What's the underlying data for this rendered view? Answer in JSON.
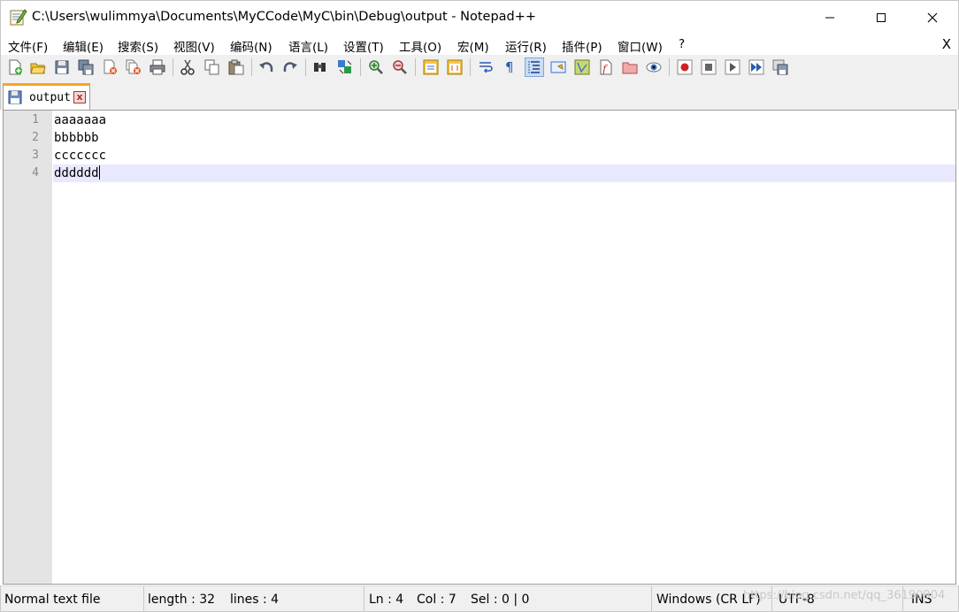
{
  "window": {
    "title": "C:\\Users\\wulimmya\\Documents\\MyCCode\\MyC\\bin\\Debug\\output - Notepad++",
    "app_icon": "notepad-plus-plus-icon",
    "controls": {
      "minimize": "minimize-icon",
      "maximize": "maximize-icon",
      "close": "close-icon"
    }
  },
  "menu": {
    "items": [
      "文件(F)",
      "编辑(E)",
      "搜索(S)",
      "视图(V)",
      "编码(N)",
      "语言(L)",
      "设置(T)",
      "工具(O)",
      "宏(M)",
      "运行(R)",
      "插件(P)",
      "窗口(W)",
      "?"
    ],
    "close_label": "X"
  },
  "toolbar": {
    "buttons": [
      "new-file-icon",
      "open-file-icon",
      "save-icon",
      "save-all-icon",
      "close-icon",
      "close-all-icon",
      "print-icon",
      "cut-icon",
      "copy-icon",
      "paste-icon",
      "undo-icon",
      "redo-icon",
      "find-icon",
      "replace-icon",
      "zoom-in-icon",
      "zoom-out-icon",
      "sync-vertical-icon",
      "sync-horizontal-icon",
      "word-wrap-icon",
      "show-all-characters-icon",
      "indent-guide-icon",
      "user-defined-language-icon",
      "document-map-icon",
      "function-list-icon",
      "folder-as-workspace-icon",
      "monitoring-icon",
      "record-macro-icon",
      "stop-recording-icon",
      "playback-macro-icon",
      "run-macro-multiple-icon",
      "save-macro-icon"
    ],
    "active": "indent-guide-icon"
  },
  "tabs": [
    {
      "label": "output",
      "icon": "saved-file-icon",
      "close": "x"
    }
  ],
  "editor": {
    "lines": [
      {
        "number": "1",
        "text": "aaaaaaa"
      },
      {
        "number": "2",
        "text": "bbbbbb"
      },
      {
        "number": "3",
        "text": "ccccccc"
      },
      {
        "number": "4",
        "text": "dddddd"
      }
    ],
    "current_line": 4
  },
  "status": {
    "file_type": "Normal text file",
    "length": "length : 32",
    "lines": "lines : 4",
    "ln": "Ln : 4",
    "col": "Col : 7",
    "sel": "Sel : 0 | 0",
    "eol": "Windows (CR LF)",
    "encoding": "UTF-8",
    "mode": "INS"
  },
  "watermark": "https://blog.csdn.net/qq_36190904",
  "colors": {
    "tab_accent": "#f5a623",
    "current_line": "#e8e8ff",
    "gutter": "#e4e4e4"
  }
}
